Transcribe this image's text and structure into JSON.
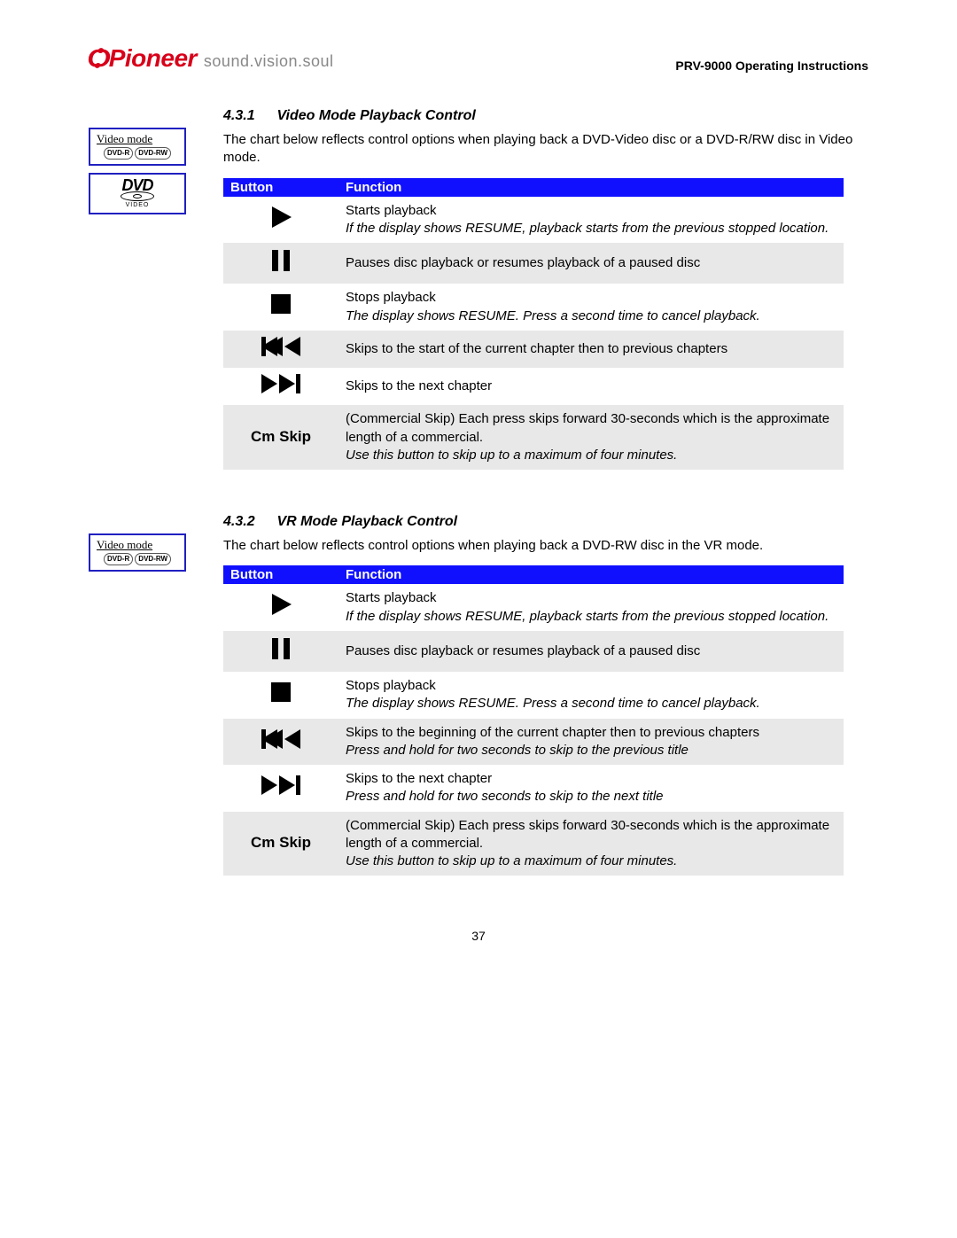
{
  "brand": {
    "name": "Pioneer",
    "tagline": "sound.vision.soul"
  },
  "doc_title": "PRV-9000 Operating Instructions",
  "page_number": "37",
  "badges": {
    "video_mode_label": "Video mode",
    "dvd_r": "DVD-R",
    "dvd_rw": "DVD-RW",
    "dvd_top": "DVD",
    "dvd_sub": "VIDEO"
  },
  "sections": [
    {
      "num": "4.3.1",
      "title": "Video Mode Playback Control",
      "intro": "The chart below reflects control options when playing back a DVD-Video disc or a DVD-R/RW disc in Video mode.",
      "header": {
        "button": "Button",
        "function": "Function"
      },
      "rows": [
        {
          "icon": "play",
          "plain": "Starts playback",
          "italic": "If the display shows RESUME, playback starts from the previous stopped location."
        },
        {
          "icon": "pause",
          "plain": "Pauses disc playback or resumes playback of a paused disc",
          "italic": ""
        },
        {
          "icon": "stop",
          "plain": "Stops playback",
          "italic": "The display shows RESUME.  Press a second time to cancel playback."
        },
        {
          "icon": "prev",
          "plain": "Skips to the start of the current chapter then to previous chapters",
          "italic": ""
        },
        {
          "icon": "next",
          "plain": "Skips to the next chapter",
          "italic": ""
        },
        {
          "icon": "cmskip",
          "label": "Cm Skip",
          "plain": "(Commercial Skip) Each press skips forward 30-seconds which is the approximate length of a commercial.",
          "italic": "Use this button to skip up to a maximum of four minutes."
        }
      ]
    },
    {
      "num": "4.3.2",
      "title": "VR Mode Playback Control",
      "intro": "The chart below reflects control options when playing back a DVD-RW disc in the VR mode.",
      "header": {
        "button": "Button",
        "function": "Function"
      },
      "rows": [
        {
          "icon": "play",
          "plain": "Starts playback",
          "italic": "If the display shows RESUME, playback starts from the previous stopped location."
        },
        {
          "icon": "pause",
          "plain": "Pauses disc playback or resumes playback of a paused disc",
          "italic": ""
        },
        {
          "icon": "stop",
          "plain": "Stops playback",
          "italic": "The display shows RESUME.  Press a second time to cancel playback."
        },
        {
          "icon": "prev",
          "plain": "Skips to the beginning of the current chapter then to previous chapters",
          "italic": "Press and hold for two seconds to skip to the previous title"
        },
        {
          "icon": "next",
          "plain": "Skips to the next chapter",
          "italic": "Press and hold for two seconds to skip to the next title"
        },
        {
          "icon": "cmskip",
          "label": "Cm Skip",
          "plain": "(Commercial Skip) Each press skips forward 30-seconds which is the approximate length of a commercial.",
          "italic": "Use this button to skip up to a maximum of four minutes."
        }
      ]
    }
  ]
}
